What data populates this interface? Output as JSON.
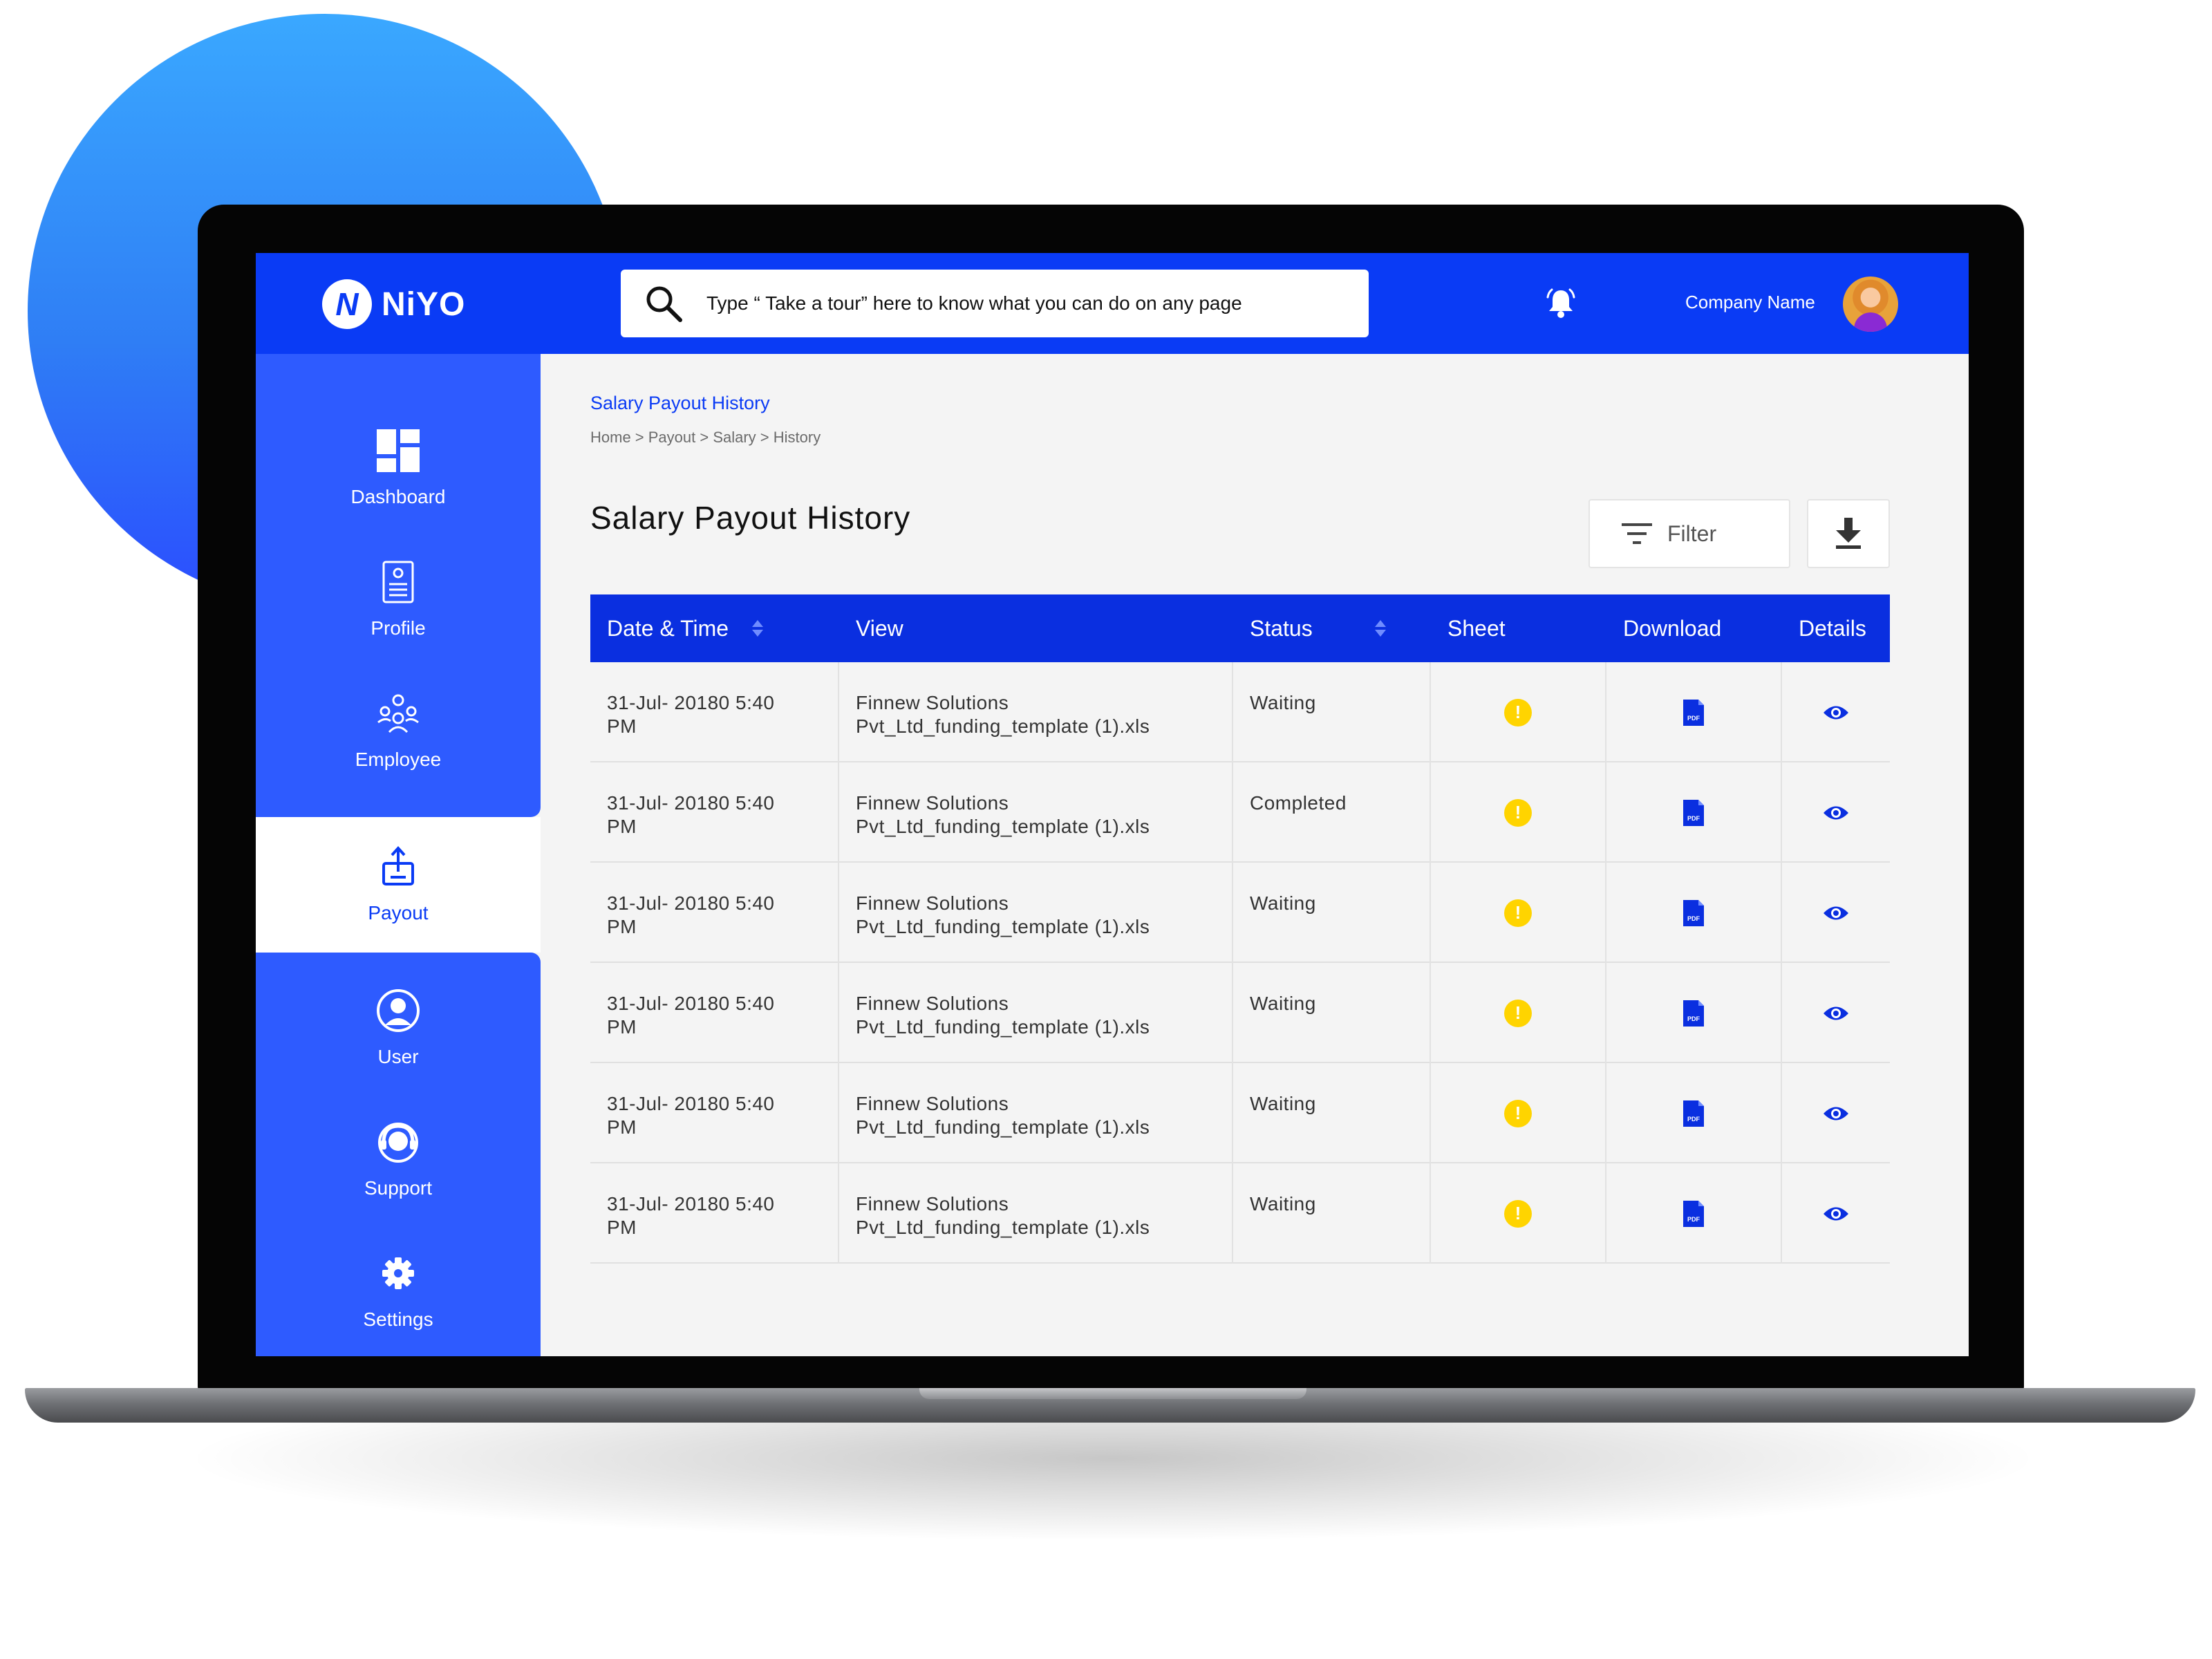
{
  "app": {
    "logo_text": "NiYO",
    "logo_mark": "N",
    "search": {
      "placeholder": "Type “ Take a tour” here to know what you can do on any page",
      "icon": "search-icon"
    },
    "company_name": "Company Name"
  },
  "colors": {
    "brand": "#0a3bf5",
    "sidebar": "#2e5bff",
    "table_header": "#0a2fe0",
    "warning": "#ffd400"
  },
  "sidebar": {
    "items": [
      {
        "label": "Dashboard",
        "icon": "dashboard-icon",
        "active": false
      },
      {
        "label": "Profile",
        "icon": "profile-document-icon",
        "active": false
      },
      {
        "label": "Employee",
        "icon": "employee-group-icon",
        "active": false
      },
      {
        "label": "Payout",
        "icon": "payout-icon",
        "active": true
      },
      {
        "label": "User",
        "icon": "user-icon",
        "active": false
      },
      {
        "label": "Support",
        "icon": "support-headset-icon",
        "active": false
      },
      {
        "label": "Settings",
        "icon": "settings-gear-icon",
        "active": false
      }
    ]
  },
  "page": {
    "breadcrumb_title": "Salary Payout History",
    "breadcrumb_path": "Home > Payout > Salary > History",
    "title": "Salary Payout History",
    "filter_label": "Filter"
  },
  "table": {
    "columns": [
      "Date & Time",
      "View",
      "Status",
      "Sheet",
      "Download",
      "Details"
    ],
    "rows": [
      {
        "date_line1": "31-Jul- 20180 5:40",
        "date_line2": "PM",
        "view_line1": "Finnew Solutions",
        "view_line2": "Pvt_Ltd_funding_template (1).xls",
        "status": "Waiting"
      },
      {
        "date_line1": "31-Jul- 20180 5:40",
        "date_line2": "PM",
        "view_line1": "Finnew Solutions",
        "view_line2": "Pvt_Ltd_funding_template (1).xls",
        "status": "Completed"
      },
      {
        "date_line1": "31-Jul- 20180 5:40",
        "date_line2": "PM",
        "view_line1": "Finnew Solutions",
        "view_line2": "Pvt_Ltd_funding_template (1).xls",
        "status": "Waiting"
      },
      {
        "date_line1": "31-Jul- 20180 5:40",
        "date_line2": "PM",
        "view_line1": "Finnew Solutions",
        "view_line2": "Pvt_Ltd_funding_template (1).xls",
        "status": "Waiting"
      },
      {
        "date_line1": "31-Jul- 20180 5:40",
        "date_line2": "PM",
        "view_line1": "Finnew Solutions",
        "view_line2": "Pvt_Ltd_funding_template (1).xls",
        "status": "Waiting"
      },
      {
        "date_line1": "31-Jul- 20180 5:40",
        "date_line2": "PM",
        "view_line1": "Finnew Solutions",
        "view_line2": "Pvt_Ltd_funding_template (1).xls",
        "status": "Waiting"
      }
    ],
    "sheet_icon": "warning-icon",
    "sheet_symbol": "!",
    "download_icon": "pdf-file-icon",
    "pdf_text": "PDF",
    "details_icon": "eye-icon"
  },
  "pagination": {
    "prev_icon": "chevron-left-icon",
    "next_icon": "chevron-right-icon"
  }
}
